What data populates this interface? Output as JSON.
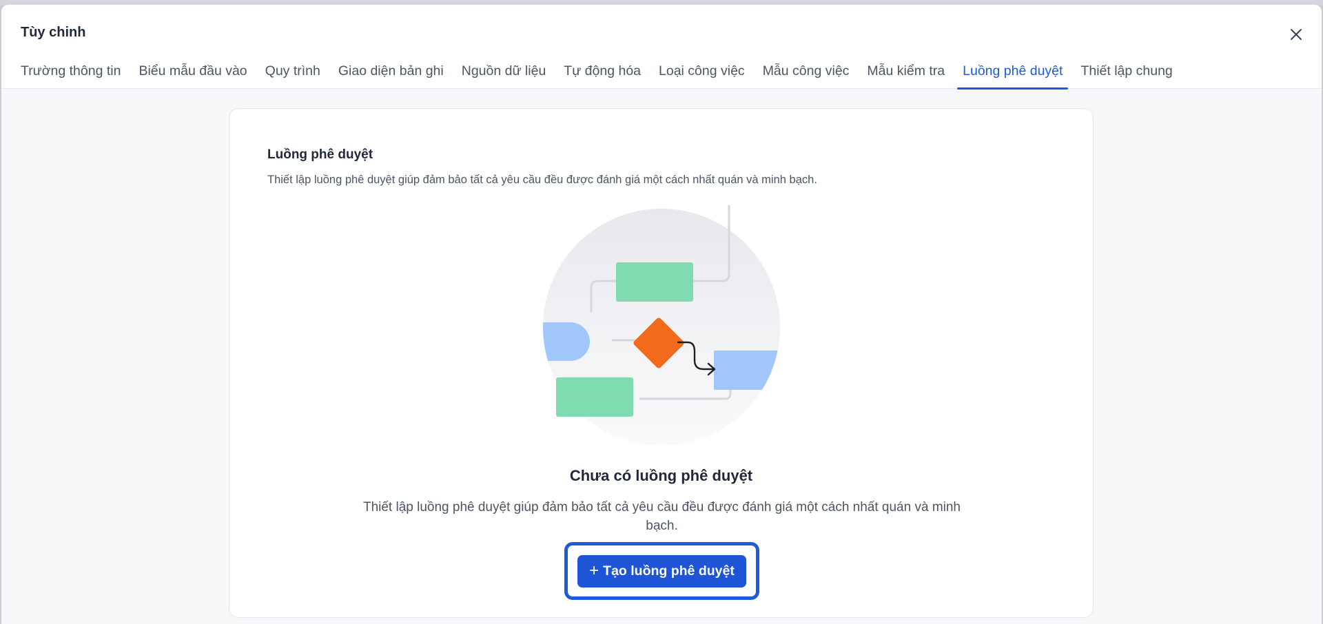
{
  "modal": {
    "title": "Tùy chinh",
    "close_icon": "close-icon"
  },
  "tabs": [
    {
      "label": "Trường thông tin",
      "active": false
    },
    {
      "label": "Biểu mẫu đầu vào",
      "active": false
    },
    {
      "label": "Quy trình",
      "active": false
    },
    {
      "label": "Giao diện bản ghi",
      "active": false
    },
    {
      "label": "Nguồn dữ liệu",
      "active": false
    },
    {
      "label": "Tự động hóa",
      "active": false
    },
    {
      "label": "Loại công việc",
      "active": false
    },
    {
      "label": "Mẫu công việc",
      "active": false
    },
    {
      "label": "Mẫu kiểm tra",
      "active": false
    },
    {
      "label": "Luồng phê duyệt",
      "active": true
    },
    {
      "label": "Thiết lập chung",
      "active": false
    }
  ],
  "section": {
    "title": "Luồng phê duyệt",
    "description": "Thiết lập luồng phê duyệt giúp đảm bảo tất cả yêu cầu đều được đánh giá một cách nhất quán và minh bạch."
  },
  "empty_state": {
    "illustration_icon": "approval-flow-illustration",
    "title": "Chưa có luồng phê duyệt",
    "description": "Thiết lập luồng phê duyệt giúp đảm bảo tất cả yêu cầu đều được đánh giá một cách nhất quán và minh bạch.",
    "button_label": "Tạo luồng phê duyệt",
    "button_icon": "plus-icon"
  },
  "colors": {
    "accent": "#1d5bd8",
    "green": "#80dbb1",
    "blue": "#a0c6fa",
    "orange": "#f26b1d"
  }
}
